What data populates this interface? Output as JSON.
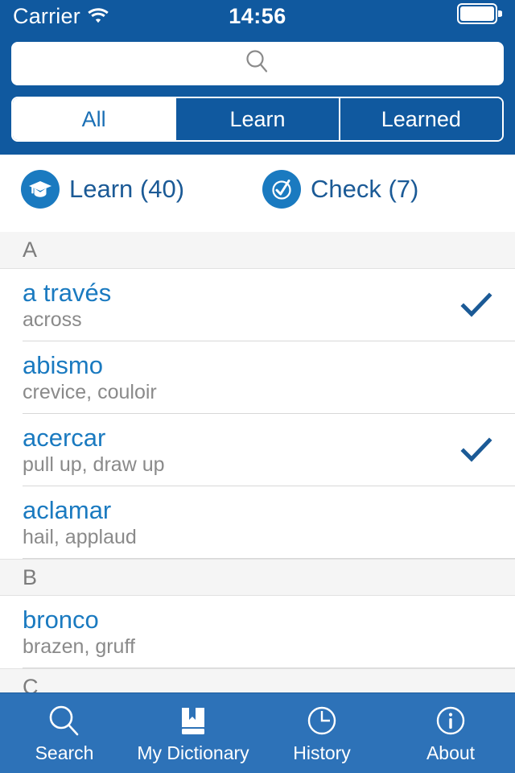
{
  "statusbar": {
    "carrier": "Carrier",
    "wifi_icon": "wifi-icon",
    "time": "14:56",
    "battery_icon": "battery-icon"
  },
  "search": {
    "value": "",
    "placeholder": "",
    "icon": "search-icon"
  },
  "segmented": {
    "options": [
      {
        "label": "All",
        "selected": true
      },
      {
        "label": "Learn",
        "selected": false
      },
      {
        "label": "Learned",
        "selected": false
      }
    ]
  },
  "actions": {
    "learn": {
      "label": "Learn (40)",
      "count": 40,
      "icon": "graduation-cap-icon"
    },
    "check": {
      "label": "Check (7)",
      "count": 7,
      "icon": "check-circle-icon"
    }
  },
  "list": {
    "sections": [
      {
        "letter": "A",
        "entries": [
          {
            "word": "a través",
            "translation": "across",
            "checked": true
          },
          {
            "word": "abismo",
            "translation": "crevice, couloir",
            "checked": false
          },
          {
            "word": "acercar",
            "translation": "pull up, draw up",
            "checked": true
          },
          {
            "word": "aclamar",
            "translation": "hail, applaud",
            "checked": false
          }
        ]
      },
      {
        "letter": "B",
        "entries": [
          {
            "word": "bronco",
            "translation": "brazen, gruff",
            "checked": false
          }
        ]
      },
      {
        "letter": "C",
        "entries": []
      }
    ]
  },
  "tabbar": {
    "tabs": [
      {
        "label": "Search",
        "icon": "search-icon"
      },
      {
        "label": "My Dictionary",
        "icon": "book-bookmark-icon"
      },
      {
        "label": "History",
        "icon": "clock-icon"
      },
      {
        "label": "About",
        "icon": "info-circle-icon"
      }
    ]
  },
  "colors": {
    "nav_blue": "#10599f",
    "tabbar_blue": "#2d72b8",
    "word_blue": "#1a7ac0",
    "action_text_blue": "#1b5a96",
    "check_blue": "#1b5a96",
    "section_bg": "#f5f5f5",
    "translation_gray": "#8a8a8a"
  }
}
